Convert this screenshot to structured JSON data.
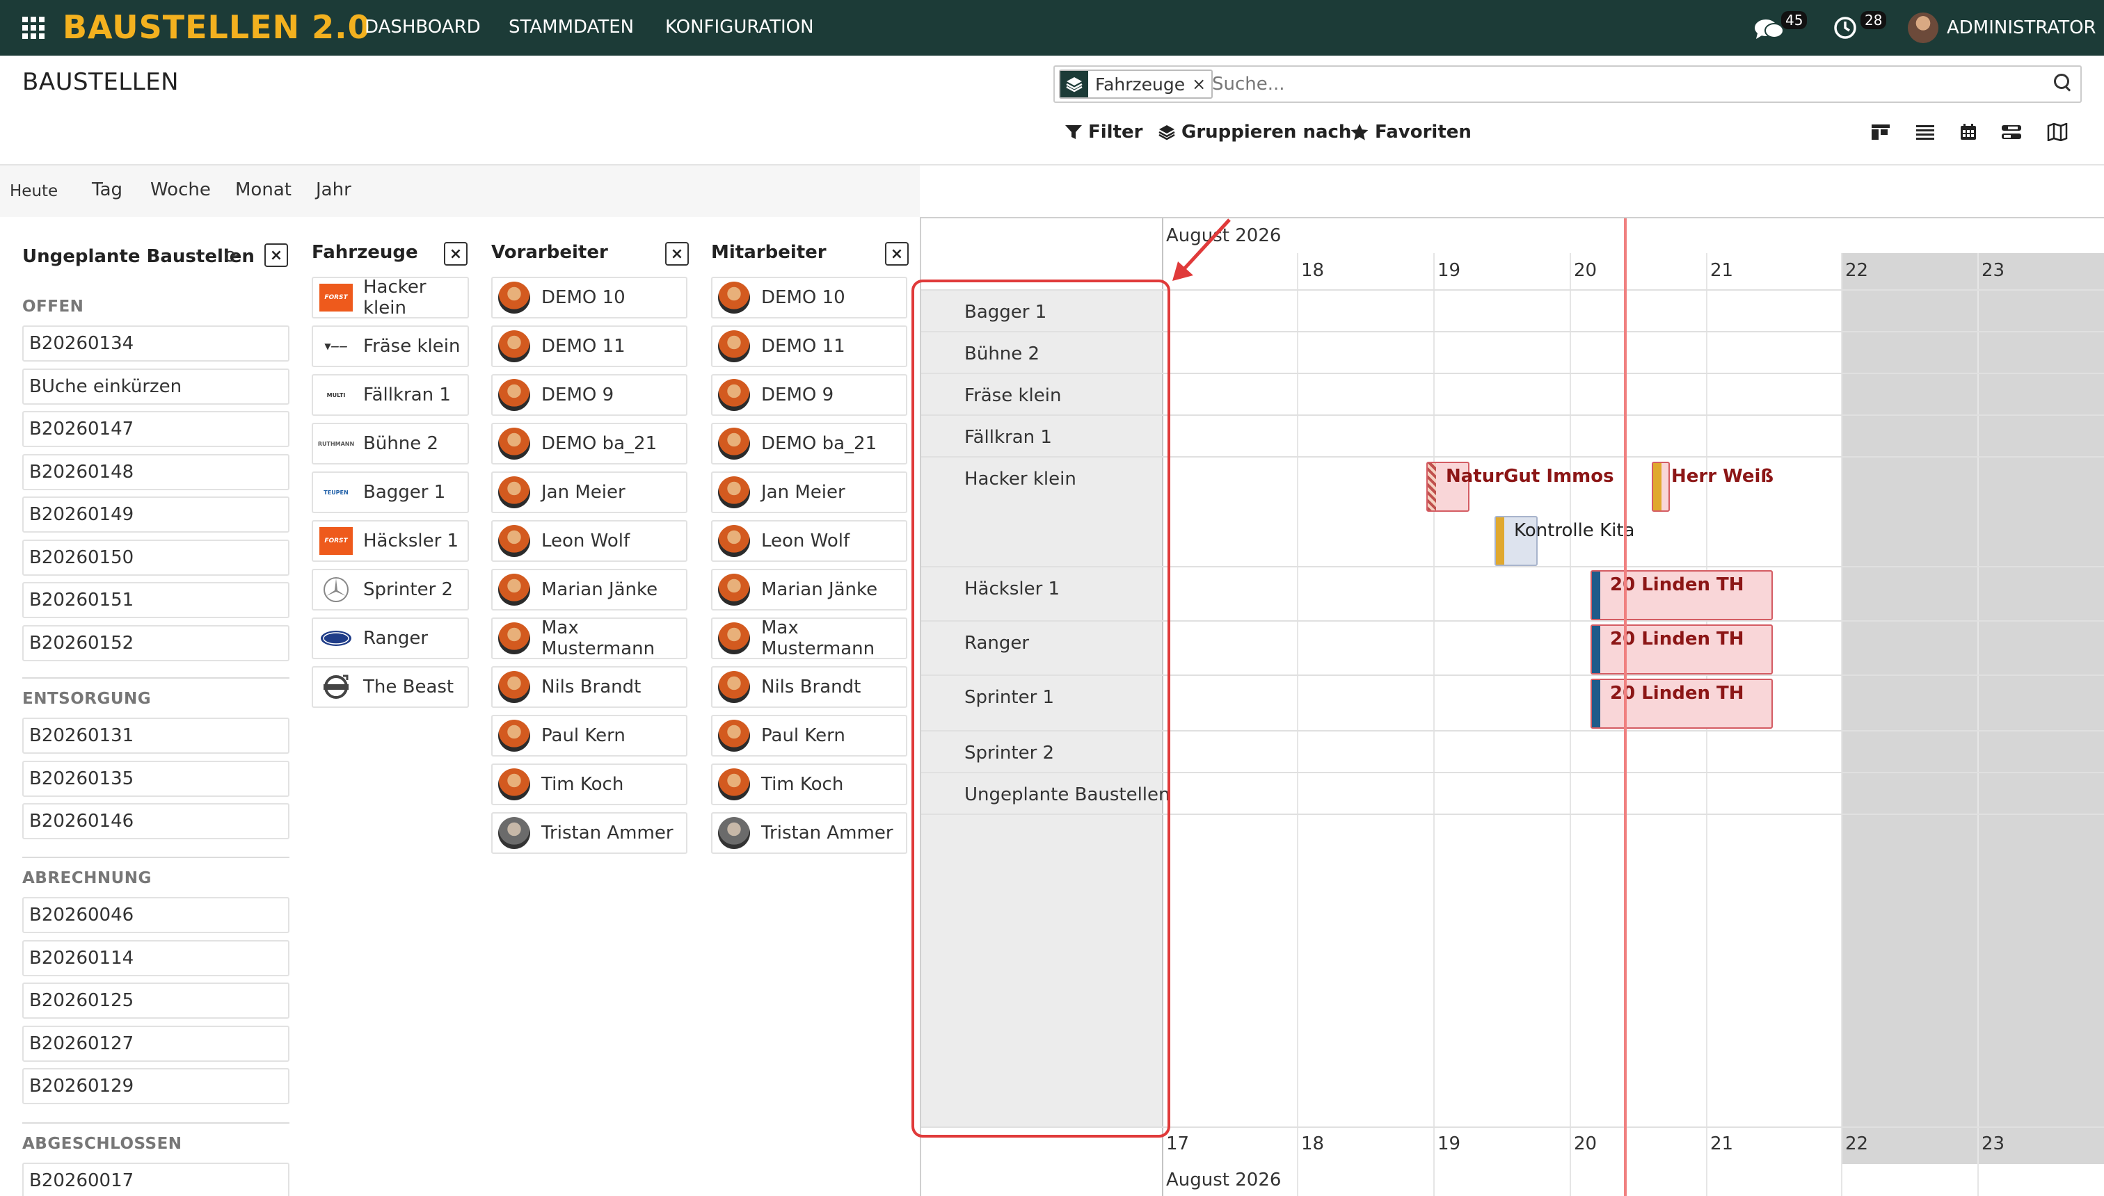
{
  "topbar": {
    "brand": "BAUSTELLEN 2.0",
    "menu": [
      "DASHBOARD",
      "STAMMDATEN",
      "KONFIGURATION"
    ],
    "messages_count": "45",
    "activities_count": "28",
    "user": "ADMINISTRATOR",
    "bg_color": "#1c3b37",
    "brand_color": "#f3b11f"
  },
  "page": {
    "title": "BAUSTELLEN"
  },
  "search": {
    "facet_label": "Fahrzeuge",
    "facet_remove": "×",
    "placeholder": "Suche..."
  },
  "control": {
    "filter": "Filter",
    "group_by": "Gruppieren nach",
    "favorites": "Favoriten",
    "views": [
      "kanban-icon",
      "list-icon",
      "calendar-icon",
      "gantt-icon",
      "map-icon"
    ]
  },
  "range": {
    "today": "Heute",
    "options": [
      "Tag",
      "Woche",
      "Monat",
      "Jahr"
    ]
  },
  "panels": {
    "close": "×",
    "unplanned": {
      "title": "Ungeplante Baustellen",
      "groups": [
        {
          "label": "OFFEN",
          "items": [
            "B20260134",
            "BUche einkürzen",
            "B20260147",
            "B20260148",
            "B20260149",
            "B20260150",
            "B20260151",
            "B20260152"
          ]
        },
        {
          "label": "ENTSORGUNG",
          "items": [
            "B20260131",
            "B20260135",
            "B20260146"
          ]
        },
        {
          "label": "ABRECHNUNG",
          "items": [
            "B20260046",
            "B20260114",
            "B20260125",
            "B20260127",
            "B20260129"
          ]
        },
        {
          "label": "ABGESCHLOSSEN",
          "items": [
            "B20260017"
          ]
        }
      ]
    },
    "vehicles": {
      "title": "Fahrzeuge",
      "items": [
        {
          "name": "Hacker klein",
          "logo": "FORST",
          "color": "#ee5a1c"
        },
        {
          "name": "Fräse klein",
          "logo": "V",
          "color": "#333333"
        },
        {
          "name": "Fällkran 1",
          "logo": "MULTI",
          "color": "#333333"
        },
        {
          "name": "Bühne 2",
          "logo": "RUTHMANN",
          "color": "#555555"
        },
        {
          "name": "Bagger 1",
          "logo": "TEUPEN",
          "color": "#1f5fa8"
        },
        {
          "name": "Häcksler 1",
          "logo": "FORST",
          "color": "#ee5a1c"
        },
        {
          "name": "Sprinter 2",
          "logo": "mercedes-star",
          "color": "#888888"
        },
        {
          "name": "Ranger",
          "logo": "FORD",
          "color": "#1f3c88"
        },
        {
          "name": "The Beast",
          "logo": "VOLVO",
          "color": "#444444"
        }
      ]
    },
    "foremen": {
      "title": "Vorarbeiter",
      "items": [
        "DEMO 10",
        "DEMO 11",
        "DEMO 9",
        "DEMO ba_21",
        "Jan Meier",
        "Leon Wolf",
        "Marian Jänke",
        "Max Mustermann",
        "Nils Brandt",
        "Paul Kern",
        "Tim Koch",
        "Tristan Ammer"
      ]
    },
    "workers": {
      "title": "Mitarbeiter",
      "items": [
        "DEMO 10",
        "DEMO 11",
        "DEMO 9",
        "DEMO ba_21",
        "Jan Meier",
        "Leon Wolf",
        "Marian Jänke",
        "Max Mustermann",
        "Nils Brandt",
        "Paul Kern",
        "Tim Koch",
        "Tristan Ammer"
      ]
    }
  },
  "gantt": {
    "month": "August 2026",
    "days": [
      "17",
      "18",
      "19",
      "20",
      "21",
      "22",
      "23"
    ],
    "rows": [
      "Bagger 1",
      "Bühne 2",
      "Fräse klein",
      "Fällkran 1",
      "Hacker klein",
      "Häcksler 1",
      "Ranger",
      "Sprinter 1",
      "Sprinter 2",
      "Ungeplante Baustellen"
    ],
    "tasks": [
      {
        "label": "NaturGut Immos",
        "row": "Hacker klein",
        "stripe": "#c0504d",
        "bg": "#f9d6d8"
      },
      {
        "label": "Herr Weiß",
        "row": "Hacker klein",
        "stripe": "#e0a82e",
        "bg": "#f9d6d8"
      },
      {
        "label": "Kontrolle Kita",
        "row": "Hacker klein",
        "stripe": "#e0a82e",
        "bg": "#dde3ee"
      },
      {
        "label": "20 Linden TH",
        "row": "Häcksler 1",
        "stripe": "#1f5b8a",
        "bg": "#f9d6d8"
      },
      {
        "label": "20 Linden TH",
        "row": "Ranger",
        "stripe": "#1f5b8a",
        "bg": "#f9d6d8"
      },
      {
        "label": "20 Linden TH",
        "row": "Sprinter 1",
        "stripe": "#1f5b8a",
        "bg": "#f9d6d8"
      }
    ]
  }
}
